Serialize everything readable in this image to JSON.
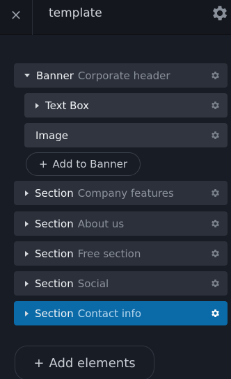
{
  "header": {
    "close_icon": "×",
    "title": "template"
  },
  "banner": {
    "label": "Banner",
    "sub": "Corporate header"
  },
  "children": [
    {
      "label": "Text Box"
    },
    {
      "label": "Image"
    }
  ],
  "add_to_banner": {
    "plus": "+",
    "label": "Add to Banner"
  },
  "sections": [
    {
      "label": "Section",
      "sub": "Company features"
    },
    {
      "label": "Section",
      "sub": "About us"
    },
    {
      "label": "Section",
      "sub": "Free section"
    },
    {
      "label": "Section",
      "sub": "Social"
    },
    {
      "label": "Section",
      "sub": "Contact info"
    }
  ],
  "add_elements": {
    "plus": "+",
    "label": "Add elements"
  },
  "colors": {
    "background": "#181c24",
    "row": "#2b303a",
    "active": "#0b6aa8"
  },
  "icons": [
    "close-icon",
    "gear-icon",
    "caret-right-icon",
    "caret-down-icon",
    "plus-icon"
  ]
}
